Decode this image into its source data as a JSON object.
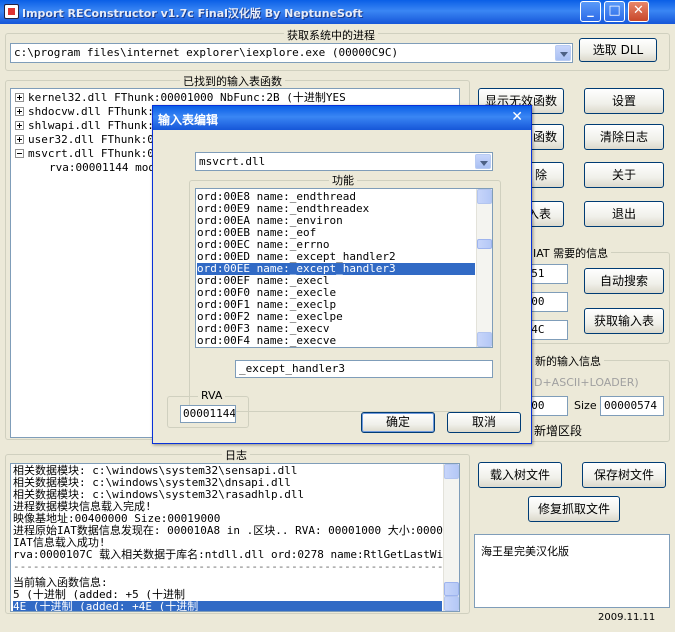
{
  "window": {
    "title": "Import REConstructor v1.7c Final汉化版   By NeptuneSoft"
  },
  "process_group": {
    "label": "获取系统中的进程",
    "selected": "c:\\program files\\internet explorer\\iexplore.exe (00000C9C)",
    "pick_dll_button": "选取 DLL"
  },
  "imports_group": {
    "label": "已找到的输入表函数",
    "tree": [
      {
        "toggle": "plus",
        "text": "kernel32.dll FThunk:00001000 NbFunc:2B (十进制YES"
      },
      {
        "toggle": "plus",
        "text": "shdocvw.dll FThunk:0"
      },
      {
        "toggle": "plus",
        "text": "shlwapi.dll FThunk:0"
      },
      {
        "toggle": "plus",
        "text": "user32.dll FThunk:00"
      },
      {
        "toggle": "minus",
        "text": "msvcrt.dll FThunk:00"
      }
    ],
    "child": "rva:00001144 mod:"
  },
  "mid_buttons": {
    "show_invalid": "显示无效函数",
    "b2": "函数",
    "b3": "除",
    "b4": "入表"
  },
  "right_buttons": {
    "settings": "设置",
    "clear_log": "清除日志",
    "about": "关于",
    "exit": "退出"
  },
  "iat_group": {
    "label": "IAT 需要的信息",
    "oep_value": "2451",
    "rva_value": "1000",
    "size_value": "D14C",
    "auto_search": "自动搜索",
    "get_imports": "获取输入表"
  },
  "new_import_group": {
    "label": "新的输入信息",
    "options_hint": "D+ASCII+LOADER)",
    "rva_value": "0000",
    "size_label": "Size",
    "size_value": "00000574",
    "new_section": "新增区段"
  },
  "log_group": {
    "label": "日志",
    "lines": [
      "相关数据模块:  c:\\windows\\system32\\sensapi.dll",
      "相关数据模块:  c:\\windows\\system32\\dnsapi.dll",
      "相关数据模块:  c:\\windows\\system32\\rasadhlp.dll",
      "进程数据模块信息载入完成!",
      "映像基地址:00400000 Size:00019000",
      "进程原始IAT数据信息发现在: 000010A8 in .区块.. RVA: 00001000 大小:00001I",
      "IAT信息载入成功!",
      "rva:0000107C 载入相关数据于库名:ntdll.dll ord:0278 name:RtlGetLastWin32E",
      "------------------------------------------------------------------------",
      "当前输入函数信息:",
      "5 (十进制 (added: +5 (十进制",
      "4E (十进制 (added: +4E (十进制"
    ]
  },
  "tree_buttons": {
    "load_tree": "载入树文件",
    "save_tree": "保存树文件",
    "fix_dump": "修复抓取文件"
  },
  "credit": "海王星完美汉化版",
  "date": "2009.11.11",
  "dialog": {
    "title": "输入表编辑",
    "module": "msvcrt.dll",
    "function_label": "功能",
    "functions": [
      "ord:00E8 name:_endthread",
      "ord:00E9 name:_endthreadex",
      "ord:00EA name:_environ",
      "ord:00EB name:_eof",
      "ord:00EC name:_errno",
      "ord:00ED name:_except_handler2",
      "ord:00EE name:_except_handler3",
      "ord:00EF name:_execl",
      "ord:00F0 name:_execle",
      "ord:00F1 name:_execlp",
      "ord:00F2 name:_execlpe",
      "ord:00F3 name:_execv",
      "ord:00F4 name:_execve"
    ],
    "selected_index": 6,
    "function_name": "_except_handler3",
    "rva_label": "RVA",
    "rva_value": "00001144",
    "ok": "确定",
    "cancel": "取消"
  }
}
